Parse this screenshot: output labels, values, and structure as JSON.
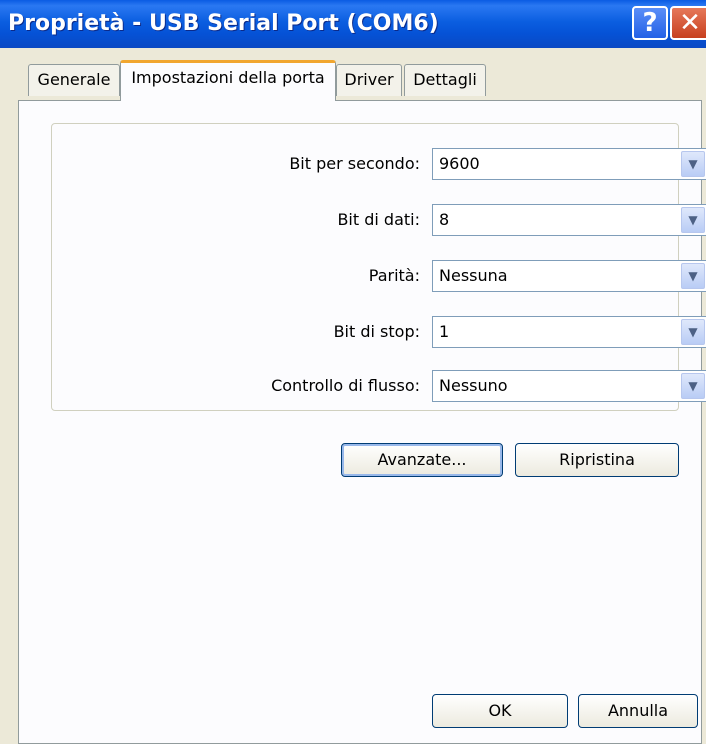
{
  "window": {
    "title": "Proprietà - USB Serial Port (COM6)",
    "help_label": "?",
    "close_label": "✕"
  },
  "tabs": [
    {
      "label": "Generale"
    },
    {
      "label": "Impostazioni della porta"
    },
    {
      "label": "Driver"
    },
    {
      "label": "Dettagli"
    }
  ],
  "active_tab": "Impostazioni della porta",
  "settings": {
    "bits_per_second": {
      "label": "Bit per secondo:",
      "value": "9600"
    },
    "data_bits": {
      "label": "Bit di dati:",
      "value": "8"
    },
    "parity": {
      "label": "Parità:",
      "value": "Nessuna"
    },
    "stop_bits": {
      "label": "Bit di stop:",
      "value": "1"
    },
    "flow_control": {
      "label": "Controllo di flusso:",
      "value": "Nessuno"
    }
  },
  "buttons": {
    "advanced": "Avanzate...",
    "restore": "Ripristina",
    "ok": "OK",
    "cancel": "Annulla"
  },
  "colors": {
    "titlebar": "#0a5be3",
    "dialog_bg": "#ece9d8",
    "active_tab_accent": "#f1a62f"
  }
}
